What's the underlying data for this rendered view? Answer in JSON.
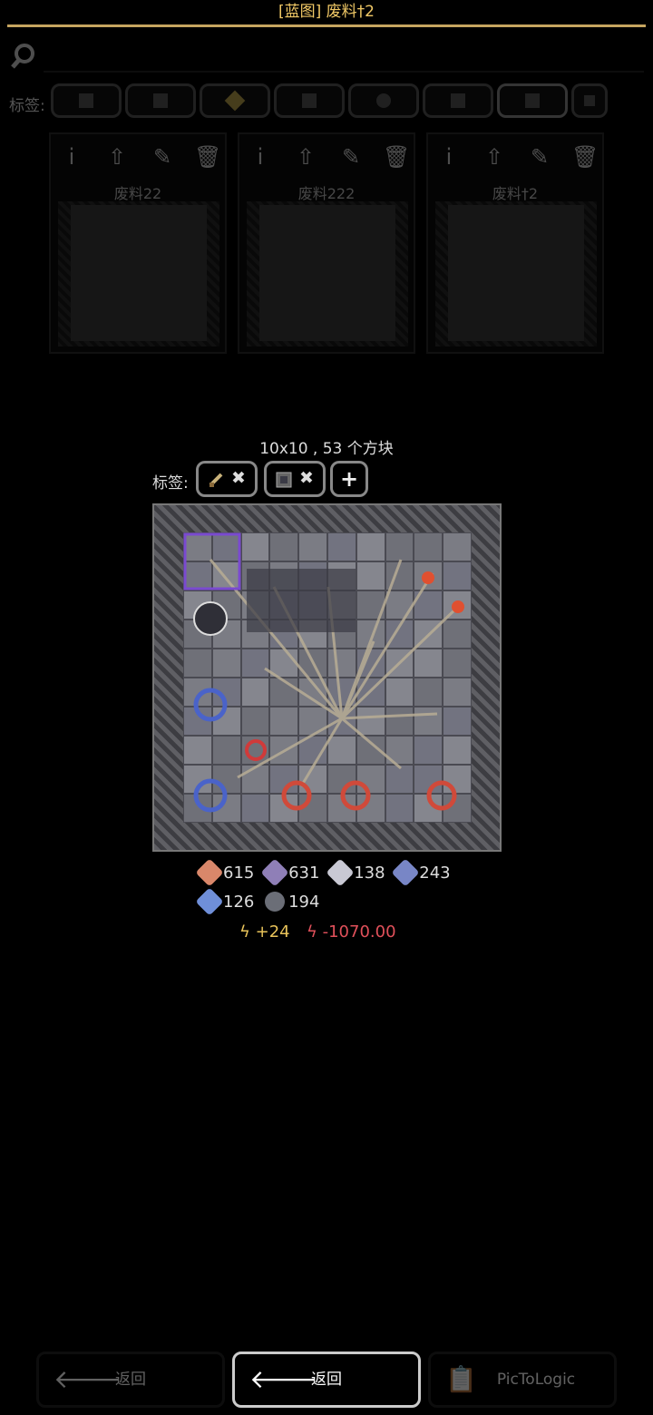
{
  "header": {
    "title": "[蓝图] 废料†2"
  },
  "search": {
    "placeholder": ""
  },
  "tags_bar": {
    "label": "标签:"
  },
  "schematics": [
    {
      "name": "废料22"
    },
    {
      "name": "废料222"
    },
    {
      "name": "废料†2"
    }
  ],
  "dialog": {
    "dimensions": "10x10 , 53 个方块",
    "tags_label": "标签:",
    "add_tag": "+",
    "remove_tag": "✖",
    "resources": [
      {
        "icon": "copper-icon",
        "amount": "615",
        "color": "#d9876a"
      },
      {
        "icon": "lead-icon",
        "amount": "631",
        "color": "#8f7fb7"
      },
      {
        "icon": "metaglass-icon",
        "amount": "138",
        "color": "#c9c9d4"
      },
      {
        "icon": "titanium-icon",
        "amount": "243",
        "color": "#7886c6"
      },
      {
        "icon": "silicon-icon",
        "amount": "126",
        "color": "#6f8fd9"
      },
      {
        "icon": "graphite-icon",
        "amount": "194",
        "color": "#6b6e77"
      }
    ],
    "power_gen": "+24",
    "power_use": "-1070.00",
    "power_gen_color": "#e8c35a",
    "power_use_color": "#e0505a"
  },
  "bottom": {
    "back_left": "返回",
    "back": "返回",
    "pictologic": "PicToLogic"
  }
}
